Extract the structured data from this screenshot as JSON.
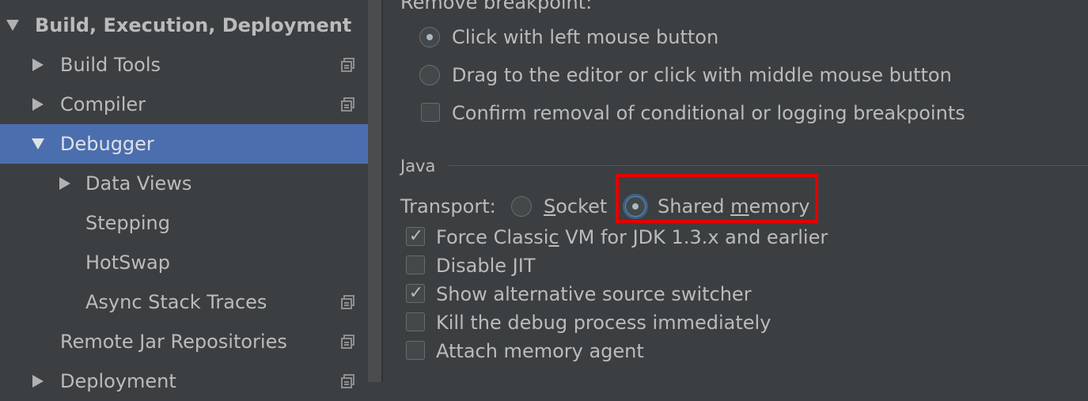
{
  "sidebar": {
    "items": [
      {
        "label": "Build, Execution, Deployment",
        "expanded": true
      },
      {
        "label": "Build Tools",
        "expanded": false
      },
      {
        "label": "Compiler",
        "expanded": false
      },
      {
        "label": "Debugger",
        "expanded": true,
        "selected": true
      },
      {
        "label": "Data Views",
        "expanded": false
      },
      {
        "label": "Stepping"
      },
      {
        "label": "HotSwap"
      },
      {
        "label": "Async Stack Traces"
      },
      {
        "label": "Remote Jar Repositories"
      },
      {
        "label": "Deployment",
        "expanded": false
      }
    ],
    "project_icon": "project-settings-icon"
  },
  "main": {
    "remove_breakpoint_header": "Remove breakpoint:",
    "remove_options": [
      {
        "label": "Click with left mouse button",
        "checked": true
      },
      {
        "label": "Drag to the editor or click with middle mouse button",
        "checked": false
      }
    ],
    "confirm_removal": {
      "label": "Confirm removal of conditional or logging breakpoints",
      "checked": false
    },
    "java_section": {
      "title": "Java",
      "transport_label": "Transport:",
      "transport_options": [
        {
          "prefix": "",
          "mnemonic": "S",
          "suffix": "ocket",
          "checked": false
        },
        {
          "prefix": "Shared ",
          "mnemonic": "m",
          "suffix": "emory",
          "checked": true
        }
      ],
      "checkboxes": [
        {
          "prefix": "Force Classi",
          "mnemonic": "c",
          "suffix": " VM for JDK 1.3.x and earlier",
          "checked": true
        },
        {
          "prefix": "Disable JIT",
          "mnemonic": "",
          "suffix": "",
          "checked": false
        },
        {
          "prefix": "Show alternative source switcher",
          "mnemonic": "",
          "suffix": "",
          "checked": true
        },
        {
          "prefix": "Kill the debug process immediately",
          "mnemonic": "",
          "suffix": "",
          "checked": false
        },
        {
          "prefix": "Attach memory agent",
          "mnemonic": "",
          "suffix": "",
          "checked": false
        }
      ]
    }
  },
  "colors": {
    "background": "#3c3f41",
    "selection": "#4b6eaf",
    "highlight_box": "#e60000"
  }
}
